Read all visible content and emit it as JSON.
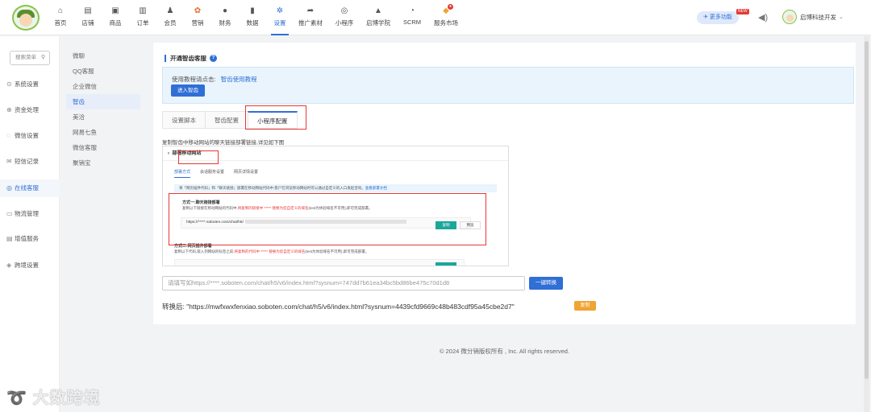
{
  "topnav": {
    "items": [
      {
        "label": "首页",
        "icon": "⌂"
      },
      {
        "label": "店铺",
        "icon": "▤"
      },
      {
        "label": "商品",
        "icon": "▣"
      },
      {
        "label": "订单",
        "icon": "▥"
      },
      {
        "label": "会员",
        "icon": "♟"
      },
      {
        "label": "营销",
        "icon": "✿"
      },
      {
        "label": "财务",
        "icon": "●"
      },
      {
        "label": "数据",
        "icon": "▮"
      },
      {
        "label": "设置",
        "icon": "✲"
      },
      {
        "label": "推广素材",
        "icon": "➦"
      },
      {
        "label": "小程序",
        "icon": "◎"
      },
      {
        "label": "启博学院",
        "icon": "▲"
      },
      {
        "label": "SCRM",
        "icon": "◔"
      },
      {
        "label": "服务市场",
        "icon": "◆"
      }
    ],
    "more_features": "更多功能",
    "new_tag": "NEW",
    "user_name": "启博科技开发"
  },
  "sidebar": {
    "search_placeholder": "搜索菜单",
    "items": [
      {
        "label": "系统设置"
      },
      {
        "label": "资金处理"
      },
      {
        "label": "微信设置"
      },
      {
        "label": "短信记录"
      },
      {
        "label": "在线客服"
      },
      {
        "label": "物流管理"
      },
      {
        "label": "增值服务"
      },
      {
        "label": "跨境设置"
      }
    ]
  },
  "submenu": {
    "items": [
      "微聊",
      "QQ客服",
      "企业微信",
      "智齿",
      "美洽",
      "网易七鱼",
      "微信客服",
      "聚销宝"
    ]
  },
  "main": {
    "title": "开通智齿客服",
    "info_text": "使用教程请点击:",
    "info_link": "智齿使用教程",
    "enter_button": "进入智齿",
    "tabs": [
      "设置脚本",
      "智齿配置",
      "小程序配置"
    ],
    "caption": "复制智齿中移动网站的聊天链接部署链接,详见如下图",
    "example": {
      "header": "部署移动网站",
      "tabs": [
        "部署方式",
        "会话服务设置",
        "网页详情设置"
      ],
      "notice": "将「网页插件代码」和「聊天链接」部署在移动网站代码中,客户在浏览移动网站时可以通过自定义的入口发起咨询。",
      "notice_link": "查看部署文档",
      "method1_title": "方式一:聊天链接部署",
      "method1_desc_a": "复制以下链接在移动网站的代码中,",
      "method1_desc_red": "将复制的链接中 ***** 替换为您自定义的域名",
      "method1_desc_b": "(test为体验域名不可用),即可完成部署。",
      "url_prefix": "https://*****.soboten.com/chat/h5/",
      "copy_label": "复制",
      "preview_label": "预览",
      "method2_title": "方式二:网页插件部署",
      "method2_desc_a": "复制以下代码,嵌入到网站的标签之前,",
      "method2_desc_red": "将复制的代码中 ***** 替换为您自定义的域名",
      "method2_desc_b": "(test为体验域名不可用),即可完成部署。"
    },
    "url_input_value": "请填写如https://****.soboten.com/chat/h5/v6/index.html?sysnum=747dd7b61ea34bc5bd86be475c70d1d8",
    "convert_button": "一键转换",
    "result_label": "转换后:",
    "result_value": "\"https://mwfxwxfenxiao.soboten.com/chat/h5/v6/index.html?sysnum=4439cfd9669c48b483cdf95a45cbe2d7\"",
    "copy_button": "复制"
  },
  "footer": "© 2024 微分销版权所有 , Inc. All rights reserved.",
  "watermark": "大数跨境",
  "colors": {
    "accent": "#2f6fd6",
    "highlight": "#e53935",
    "copy": "#f0a431",
    "teal": "#1aa79a"
  }
}
